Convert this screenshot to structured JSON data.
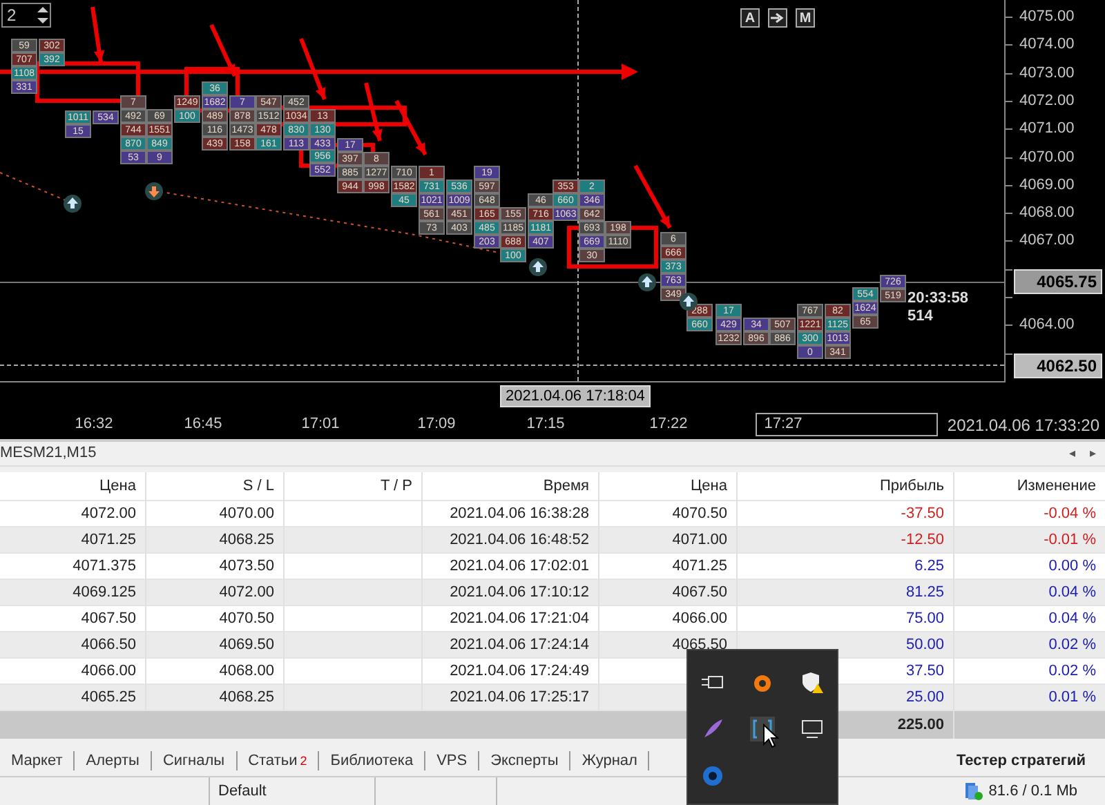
{
  "chart": {
    "spinner": {
      "value": "2"
    },
    "buttons": [
      {
        "kind": "text",
        "label": "A"
      },
      {
        "kind": "icon"
      },
      {
        "kind": "text",
        "label": "M"
      }
    ],
    "price_axis": [
      "4075.00",
      "4074.00",
      "4073.00",
      "4072.00",
      "4071.00",
      "4070.00",
      "4069.00",
      "4068.00",
      "4067.00",
      "4064.00"
    ],
    "current_price": "4065.75",
    "crosshair_price": "4062.50",
    "last_bar": {
      "time": "20:33:58",
      "volume": "514"
    },
    "clusters": [
      {
        "cells": [
          "59",
          "707",
          "1108",
          "331"
        ]
      },
      {
        "cells": [
          "302",
          "392"
        ]
      },
      {
        "cells": [
          "1011",
          "15"
        ]
      },
      {
        "cells": [
          "534"
        ]
      },
      {
        "cells": [
          "7",
          "492",
          "744",
          "870",
          "53"
        ]
      },
      {
        "cells": [
          "69",
          "1551",
          "849",
          "9"
        ]
      },
      {
        "cells": [
          "1249",
          "100"
        ]
      },
      {
        "cells": [
          "36",
          "1682",
          "489",
          "116",
          "439"
        ]
      },
      {
        "cells": [
          "7",
          "878",
          "1473",
          "158"
        ]
      },
      {
        "cells": [
          "547",
          "1512",
          "478",
          "161"
        ]
      },
      {
        "cells": [
          "452",
          "1034",
          "830",
          "113"
        ]
      },
      {
        "cells": [
          "13",
          "130",
          "433"
        ]
      },
      {
        "cells": [
          "956",
          "552"
        ]
      },
      {
        "cells": [
          "17",
          "397",
          "885",
          "944"
        ]
      },
      {
        "cells": [
          "8",
          "1277",
          "998"
        ]
      },
      {
        "cells": [
          "710",
          "1582",
          "45"
        ]
      },
      {
        "cells": [
          "1",
          "731",
          "1021",
          "561",
          "73"
        ]
      },
      {
        "cells": [
          "536",
          "1009",
          "451",
          "403"
        ]
      },
      {
        "cells": [
          "19",
          "597",
          "648",
          "165",
          "485",
          "203"
        ]
      },
      {
        "cells": [
          "155",
          "1185",
          "688",
          "100"
        ]
      },
      {
        "cells": [
          "46",
          "716",
          "1181",
          "407"
        ]
      },
      {
        "cells": [
          "353",
          "660",
          "1063"
        ]
      },
      {
        "cells": [
          "2",
          "346",
          "642",
          "693"
        ]
      },
      {
        "cells": [
          "669",
          "30"
        ]
      },
      {
        "cells": [
          "198",
          "1110"
        ]
      },
      {
        "cells": [
          "6",
          "666",
          "373",
          "763",
          "349"
        ]
      },
      {
        "cells": [
          "288",
          "660"
        ]
      },
      {
        "cells": [
          "17",
          "429",
          "1232"
        ]
      },
      {
        "cells": [
          "34",
          "896"
        ]
      },
      {
        "cells": [
          "507",
          "886"
        ]
      },
      {
        "cells": [
          "767",
          "1221",
          "300",
          "0"
        ]
      },
      {
        "cells": [
          "82",
          "1125",
          "1013",
          "341"
        ]
      },
      {
        "cells": [
          "554",
          "1624",
          "65"
        ]
      },
      {
        "cells": [
          "726",
          "519"
        ]
      }
    ]
  },
  "time_axis": {
    "ticks": [
      "16:32",
      "16:45",
      "17:01",
      "17:09",
      "17:15",
      "17:22",
      "17:27"
    ],
    "crosshair_time": "2021.04.06 17:18:04",
    "end_time": "2021.04.06 17:33:20"
  },
  "panel": {
    "title": "MESM21,M15",
    "scroll_arrows": [
      "◂",
      "▸"
    ]
  },
  "table": {
    "columns": [
      "Цена",
      "S / L",
      "T / P",
      "Время",
      "Цена",
      "Прибыль",
      "Изменение"
    ],
    "rows": [
      {
        "price": "4072.00",
        "sl": "4070.00",
        "time": "2021.04.06 16:38:28",
        "close": "4070.50",
        "profit": "-37.50",
        "change": "-0.04 %",
        "color": "#d02020"
      },
      {
        "price": "4071.25",
        "sl": "4068.25",
        "time": "2021.04.06 16:48:52",
        "close": "4071.00",
        "profit": "-12.50",
        "change": "-0.01 %",
        "color": "#d02020"
      },
      {
        "price": "4071.375",
        "sl": "4073.50",
        "time": "2021.04.06 17:02:01",
        "close": "4071.25",
        "profit": "6.25",
        "change": "0.00 %",
        "color": "#2020b0"
      },
      {
        "price": "4069.125",
        "sl": "4072.00",
        "time": "2021.04.06 17:10:12",
        "close": "4067.50",
        "profit": "81.25",
        "change": "0.04 %",
        "color": "#2020b0"
      },
      {
        "price": "4067.50",
        "sl": "4070.50",
        "time": "2021.04.06 17:21:04",
        "close": "4066.00",
        "profit": "75.00",
        "change": "0.04 %",
        "color": "#2020b0"
      },
      {
        "price": "4066.50",
        "sl": "4069.50",
        "time": "2021.04.06 17:24:14",
        "close": "4065.50",
        "profit": "50.00",
        "change": "0.02 %",
        "color": "#2020b0"
      },
      {
        "price": "4066.00",
        "sl": "4068.00",
        "time": "2021.04.06 17:24:49",
        "profit": "37.50",
        "change": "0.02 %",
        "color": "#2020b0"
      },
      {
        "price": "4065.25",
        "sl": "4068.25",
        "time": "2021.04.06 17:25:17",
        "profit": "25.00",
        "change": "0.01 %",
        "color": "#2020b0"
      }
    ],
    "total": "225.00"
  },
  "tabs": [
    {
      "label": "Маркет"
    },
    {
      "label": "Алерты"
    },
    {
      "label": "Сигналы"
    },
    {
      "label": "Статьи",
      "badge": "2"
    },
    {
      "label": "Библиотека"
    },
    {
      "label": "VPS"
    },
    {
      "label": "Эксперты"
    },
    {
      "label": "Журнал"
    }
  ],
  "tester_tab": {
    "label": "Тестер стратегий"
  },
  "status_bar": {
    "profile": "Default",
    "traffic": "81.6 / 0.1 Mb"
  }
}
